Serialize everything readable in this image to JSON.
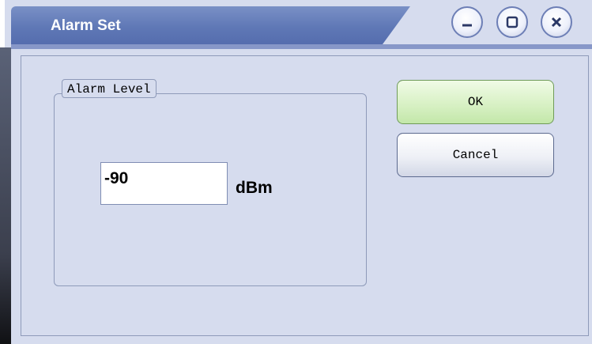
{
  "window": {
    "title": "Alarm Set"
  },
  "caption_buttons": {
    "minimize": "minimize-icon",
    "maximize": "maximize-icon",
    "close": "close-icon"
  },
  "alarm_level": {
    "group_label": "Alarm Level",
    "value": "-90",
    "unit": "dBm"
  },
  "buttons": {
    "ok_label": "OK",
    "cancel_label": "Cancel"
  },
  "colors": {
    "titlebar": "#5f78b6",
    "body": "#d6dcee",
    "ok_button": "#d6f0c2"
  }
}
